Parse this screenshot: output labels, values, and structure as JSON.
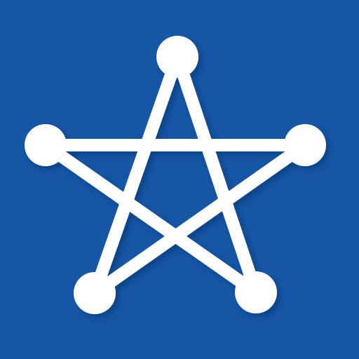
{
  "app_icon": {
    "icon": "pentagram-node-graph-icon",
    "colors": {
      "background": "#1556a6",
      "foreground": "#ffffff",
      "shadow": "#0b2f63"
    }
  }
}
